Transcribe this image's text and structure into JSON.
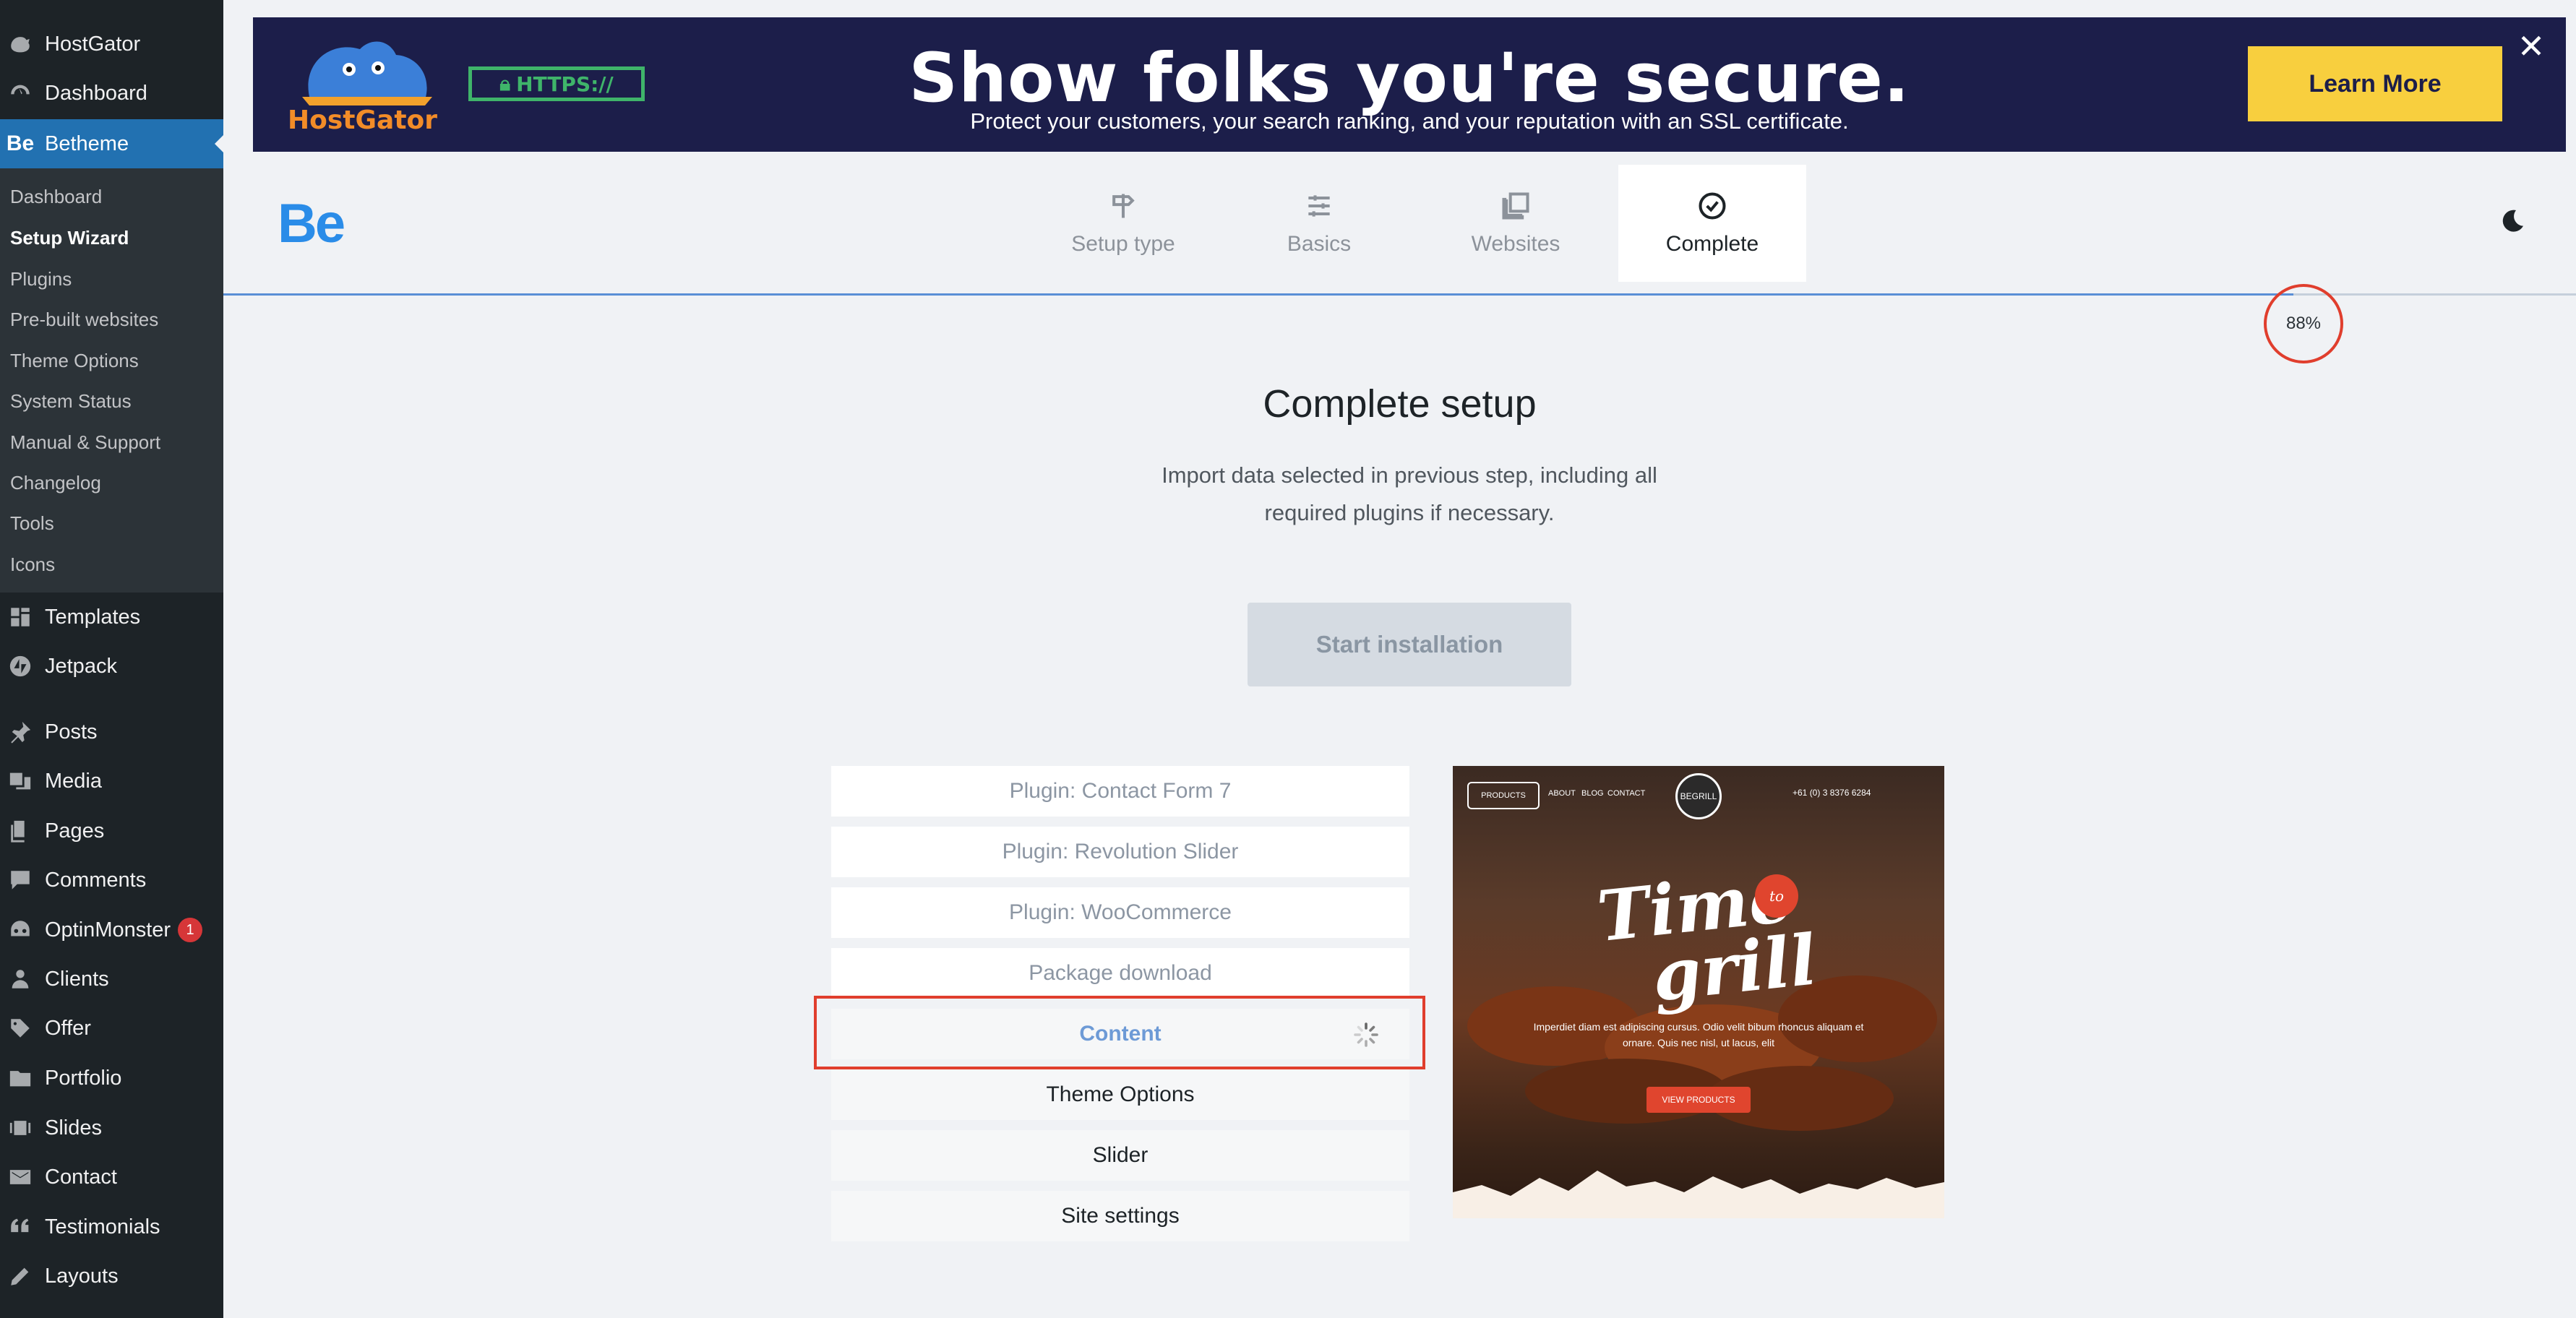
{
  "sidebar": {
    "items": [
      {
        "label": "HostGator",
        "icon": "hostgator-icon"
      },
      {
        "label": "Dashboard",
        "icon": "dashboard-icon"
      },
      {
        "label": "Betheme",
        "icon": "betheme-icon",
        "icon_text": "Be"
      },
      {
        "label": "Templates",
        "icon": "templates-icon"
      },
      {
        "label": "Jetpack",
        "icon": "jetpack-icon"
      },
      {
        "label": "Posts",
        "icon": "pin-icon"
      },
      {
        "label": "Media",
        "icon": "media-icon"
      },
      {
        "label": "Pages",
        "icon": "pages-icon"
      },
      {
        "label": "Comments",
        "icon": "comments-icon"
      },
      {
        "label": "OptinMonster",
        "icon": "optinmonster-icon",
        "badge": "1"
      },
      {
        "label": "Clients",
        "icon": "clients-icon"
      },
      {
        "label": "Offer",
        "icon": "tag-icon"
      },
      {
        "label": "Portfolio",
        "icon": "folder-icon"
      },
      {
        "label": "Slides",
        "icon": "slides-icon"
      },
      {
        "label": "Contact",
        "icon": "mail-icon"
      },
      {
        "label": "Testimonials",
        "icon": "quote-icon"
      },
      {
        "label": "Layouts",
        "icon": "edit-icon"
      }
    ],
    "submenu": [
      "Dashboard",
      "Setup Wizard",
      "Plugins",
      "Pre-built websites",
      "Theme Options",
      "System Status",
      "Manual & Support",
      "Changelog",
      "Tools",
      "Icons"
    ],
    "current_submenu": "Setup Wizard"
  },
  "banner": {
    "logo_text": "HostGator",
    "ssl_badge": "HTTPS://",
    "headline": "Show folks you're secure.",
    "subtext": "Protect your customers, your search ranking, and your reputation with an SSL certificate.",
    "cta": "Learn More",
    "close": "✕",
    "colors": {
      "background": "#1c1e4a",
      "cta": "#f8cf3e",
      "ssl": "#3fb46a"
    }
  },
  "wizard": {
    "logo": "Be",
    "steps": [
      {
        "label": "Setup type",
        "icon": "signpost-icon"
      },
      {
        "label": "Basics",
        "icon": "sliders-icon"
      },
      {
        "label": "Websites",
        "icon": "copy-icon"
      },
      {
        "label": "Complete",
        "icon": "check-circle-icon",
        "active": true
      }
    ],
    "progress_percent": 88,
    "progress_label": "88%",
    "theme_toggle_icon": "moon-icon"
  },
  "main": {
    "title": "Complete setup",
    "description_line1": "Import data selected in previous step, including all",
    "description_line2": "required plugins if necessary.",
    "start_button": "Start installation",
    "tasks": [
      {
        "label": "Plugin: Contact Form 7",
        "state": "done"
      },
      {
        "label": "Plugin: Revolution Slider",
        "state": "done"
      },
      {
        "label": "Plugin: WooCommerce",
        "state": "done"
      },
      {
        "label": "Package download",
        "state": "done"
      },
      {
        "label": "Content",
        "state": "in-progress"
      },
      {
        "label": "Theme Options",
        "state": "pending"
      },
      {
        "label": "Slider",
        "state": "pending"
      },
      {
        "label": "Site settings",
        "state": "pending"
      }
    ]
  },
  "preview": {
    "nav_button": "PRODUCTS",
    "nav_links": [
      "ABOUT",
      "BLOG",
      "CONTACT"
    ],
    "logo_text": "BEGRILL",
    "phone": "+61 (0) 3 8376 6284",
    "badge": "to",
    "title_line1": "Time",
    "title_line2": "grill",
    "text": "Imperdiet diam est adipiscing cursus. Odio velit bibum rhoncus aliquam et ornare. Quis nec nisl, ut lacus, elit",
    "cta": "VIEW PRODUCTS"
  }
}
